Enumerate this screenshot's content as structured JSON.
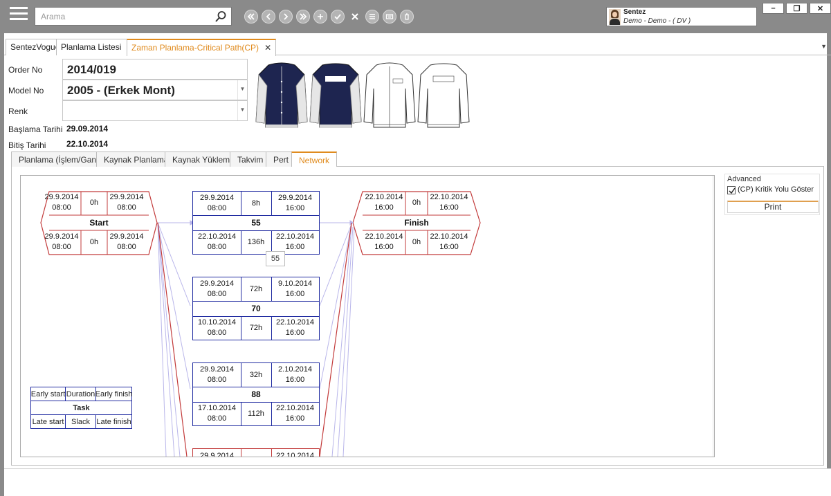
{
  "search": {
    "placeholder": "Arama"
  },
  "toolbar": {
    "buttons": [
      {
        "icon": "double-chevron-left-icon"
      },
      {
        "icon": "chevron-left-icon"
      },
      {
        "icon": "chevron-right-icon"
      },
      {
        "icon": "double-chevron-right-icon"
      },
      {
        "icon": "plus-icon"
      },
      {
        "icon": "check-icon"
      },
      {
        "icon": "x-icon"
      },
      {
        "icon": "list-icon"
      },
      {
        "icon": "keyboard-icon"
      },
      {
        "icon": "trash-icon"
      }
    ]
  },
  "user": {
    "name": "Sentez",
    "subtitle": "Demo - Demo - ( DV )"
  },
  "window_controls": {
    "minimize": "–",
    "restore": "❐",
    "close": "✕"
  },
  "doc_tabs": [
    {
      "label": "SentezVogue",
      "closable": false,
      "active": false
    },
    {
      "label": "Planlama Listesi",
      "closable": true,
      "active": false
    },
    {
      "label": "Zaman Planlama-Critical Path(CP)",
      "closable": true,
      "active": true
    }
  ],
  "form": {
    "order_no_label": "Order No",
    "order_no_value": "2014/019",
    "model_no_label": "Model No",
    "model_no_value": "2005 - (Erkek Mont)",
    "renk_label": "Renk",
    "renk_value": "",
    "start_label": "Başlama Tarihi",
    "start_value": "29.09.2014",
    "end_label": "Bitiş Tarihi",
    "end_value": "22.10.2014"
  },
  "sub_tabs": [
    {
      "label": "Planlama (İşlem/Gant)",
      "active": false
    },
    {
      "label": "Kaynak Planlama",
      "active": false
    },
    {
      "label": "Kaynak Yükleme",
      "active": false
    },
    {
      "label": "Takvim",
      "active": false
    },
    {
      "label": "Pert",
      "active": false
    },
    {
      "label": "Network",
      "active": true
    }
  ],
  "network": {
    "nodes": {
      "start": {
        "es": "29.9.2014\n08:00",
        "dur": "0h",
        "ef": "29.9.2014\n08:00",
        "name": "Start",
        "ls": "29.9.2014\n08:00",
        "slack": "0h",
        "lf": "29.9.2014\n08:00"
      },
      "n55": {
        "es": "29.9.2014\n08:00",
        "dur": "8h",
        "ef": "29.9.2014\n16:00",
        "name": "55",
        "ls": "22.10.2014\n08:00",
        "slack": "136h",
        "lf": "22.10.2014\n16:00"
      },
      "n70": {
        "es": "29.9.2014\n08:00",
        "dur": "72h",
        "ef": "9.10.2014\n16:00",
        "name": "70",
        "ls": "10.10.2014\n08:00",
        "slack": "72h",
        "lf": "22.10.2014\n16:00"
      },
      "n88": {
        "es": "29.9.2014\n08:00",
        "dur": "32h",
        "ef": "2.10.2014\n16:00",
        "name": "88",
        "ls": "17.10.2014\n08:00",
        "slack": "112h",
        "lf": "22.10.2014\n16:00"
      },
      "n_partial": {
        "es": "29.9.2014",
        "ef": "22.10.2014"
      },
      "finish": {
        "es": "22.10.2014\n16:00",
        "dur": "0h",
        "ef": "22.10.2014\n16:00",
        "name": "Finish",
        "ls": "22.10.2014\n16:00",
        "slack": "0h",
        "lf": "22.10.2014\n16:00"
      }
    },
    "link_label": "55",
    "legend": {
      "early_start": "Early start",
      "duration": "Duration",
      "early_finish": "Early finish",
      "task": "Task",
      "late_start": "Late start",
      "slack": "Slack",
      "late_finish": "Late finish"
    },
    "colors": {
      "task_border": "#1f2aa0",
      "critical_border": "#c23a3a",
      "link": "#b9b6ea"
    }
  },
  "advanced": {
    "title": "Advanced",
    "critical_path_label": "(CP) Kritik Yolu Göster",
    "critical_path_checked": true,
    "print_label": "Print"
  }
}
